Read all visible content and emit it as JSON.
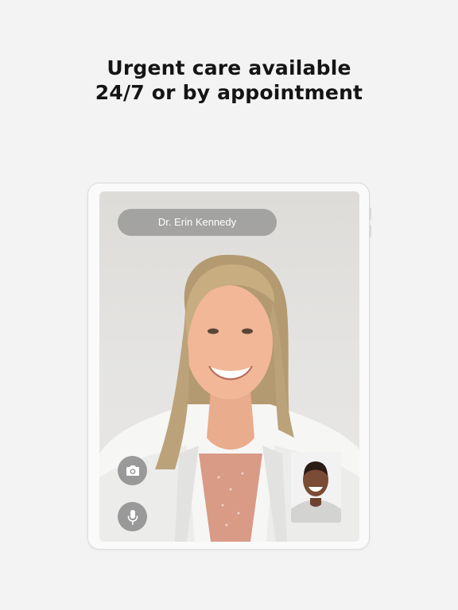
{
  "headline": {
    "line1": "Urgent care available",
    "line2": "24/7 or by appointment"
  },
  "call": {
    "caller_name": "Dr. Erin Kennedy",
    "controls": [
      {
        "icon": "camera-icon"
      },
      {
        "icon": "microphone-icon"
      }
    ]
  },
  "colors": {
    "background": "#f3f3f3",
    "headline_text": "#141414",
    "pill_bg": "#8c8c8c",
    "control_bg": "#828282"
  }
}
